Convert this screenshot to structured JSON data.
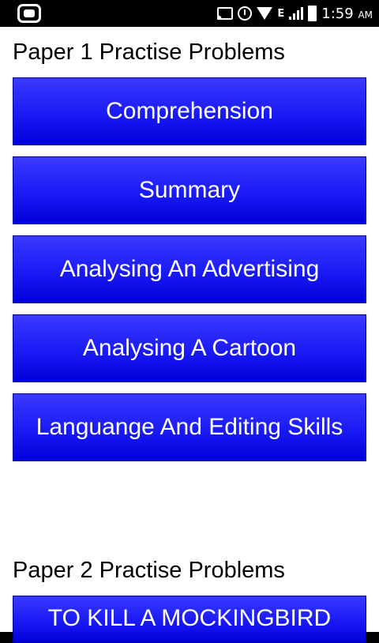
{
  "status_bar": {
    "network": "E",
    "time": "1:59",
    "ampm": "AM"
  },
  "sections": [
    {
      "title": "Paper 1 Practise Problems",
      "buttons": [
        "Comprehension",
        "Summary",
        "Analysing An Advertising",
        "Analysing A Cartoon",
        "Languange And Editing Skills"
      ]
    },
    {
      "title": "Paper 2 Practise Problems",
      "buttons": [
        "TO KILL A MOCKINGBIRD"
      ]
    }
  ]
}
